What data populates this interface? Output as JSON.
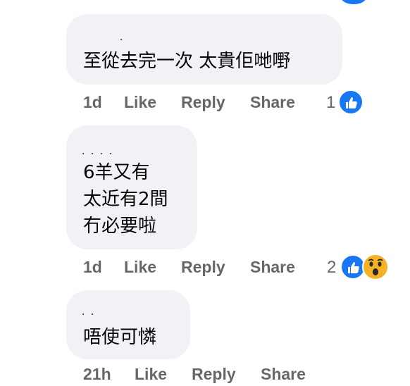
{
  "comments": [
    {
      "text": "至從去完一次 太貴佢哋嘢",
      "author_redacted": "·",
      "actions": {
        "time": "1d",
        "like": "Like",
        "reply": "Reply",
        "share": "Share"
      },
      "reaction_count": "1",
      "reactions": [
        "like-icon"
      ]
    },
    {
      "text": "6羊又有\n太近有2間\n冇必要啦",
      "author_redacted": "· · · ·",
      "actions": {
        "time": "1d",
        "like": "Like",
        "reply": "Reply",
        "share": "Share"
      },
      "reaction_count": "2",
      "reactions": [
        "like-icon",
        "wow-icon"
      ]
    },
    {
      "text": "唔使可憐",
      "author_redacted": "·          ·",
      "actions": {
        "time": "21h",
        "like": "Like",
        "reply": "Reply",
        "share": "Share"
      },
      "reaction_count": "",
      "reactions": []
    }
  ],
  "colors": {
    "bubble": "#f0f2f5",
    "meta": "#65676b",
    "text": "#050505",
    "like": "#1877f2",
    "wow": "#f7b125"
  }
}
